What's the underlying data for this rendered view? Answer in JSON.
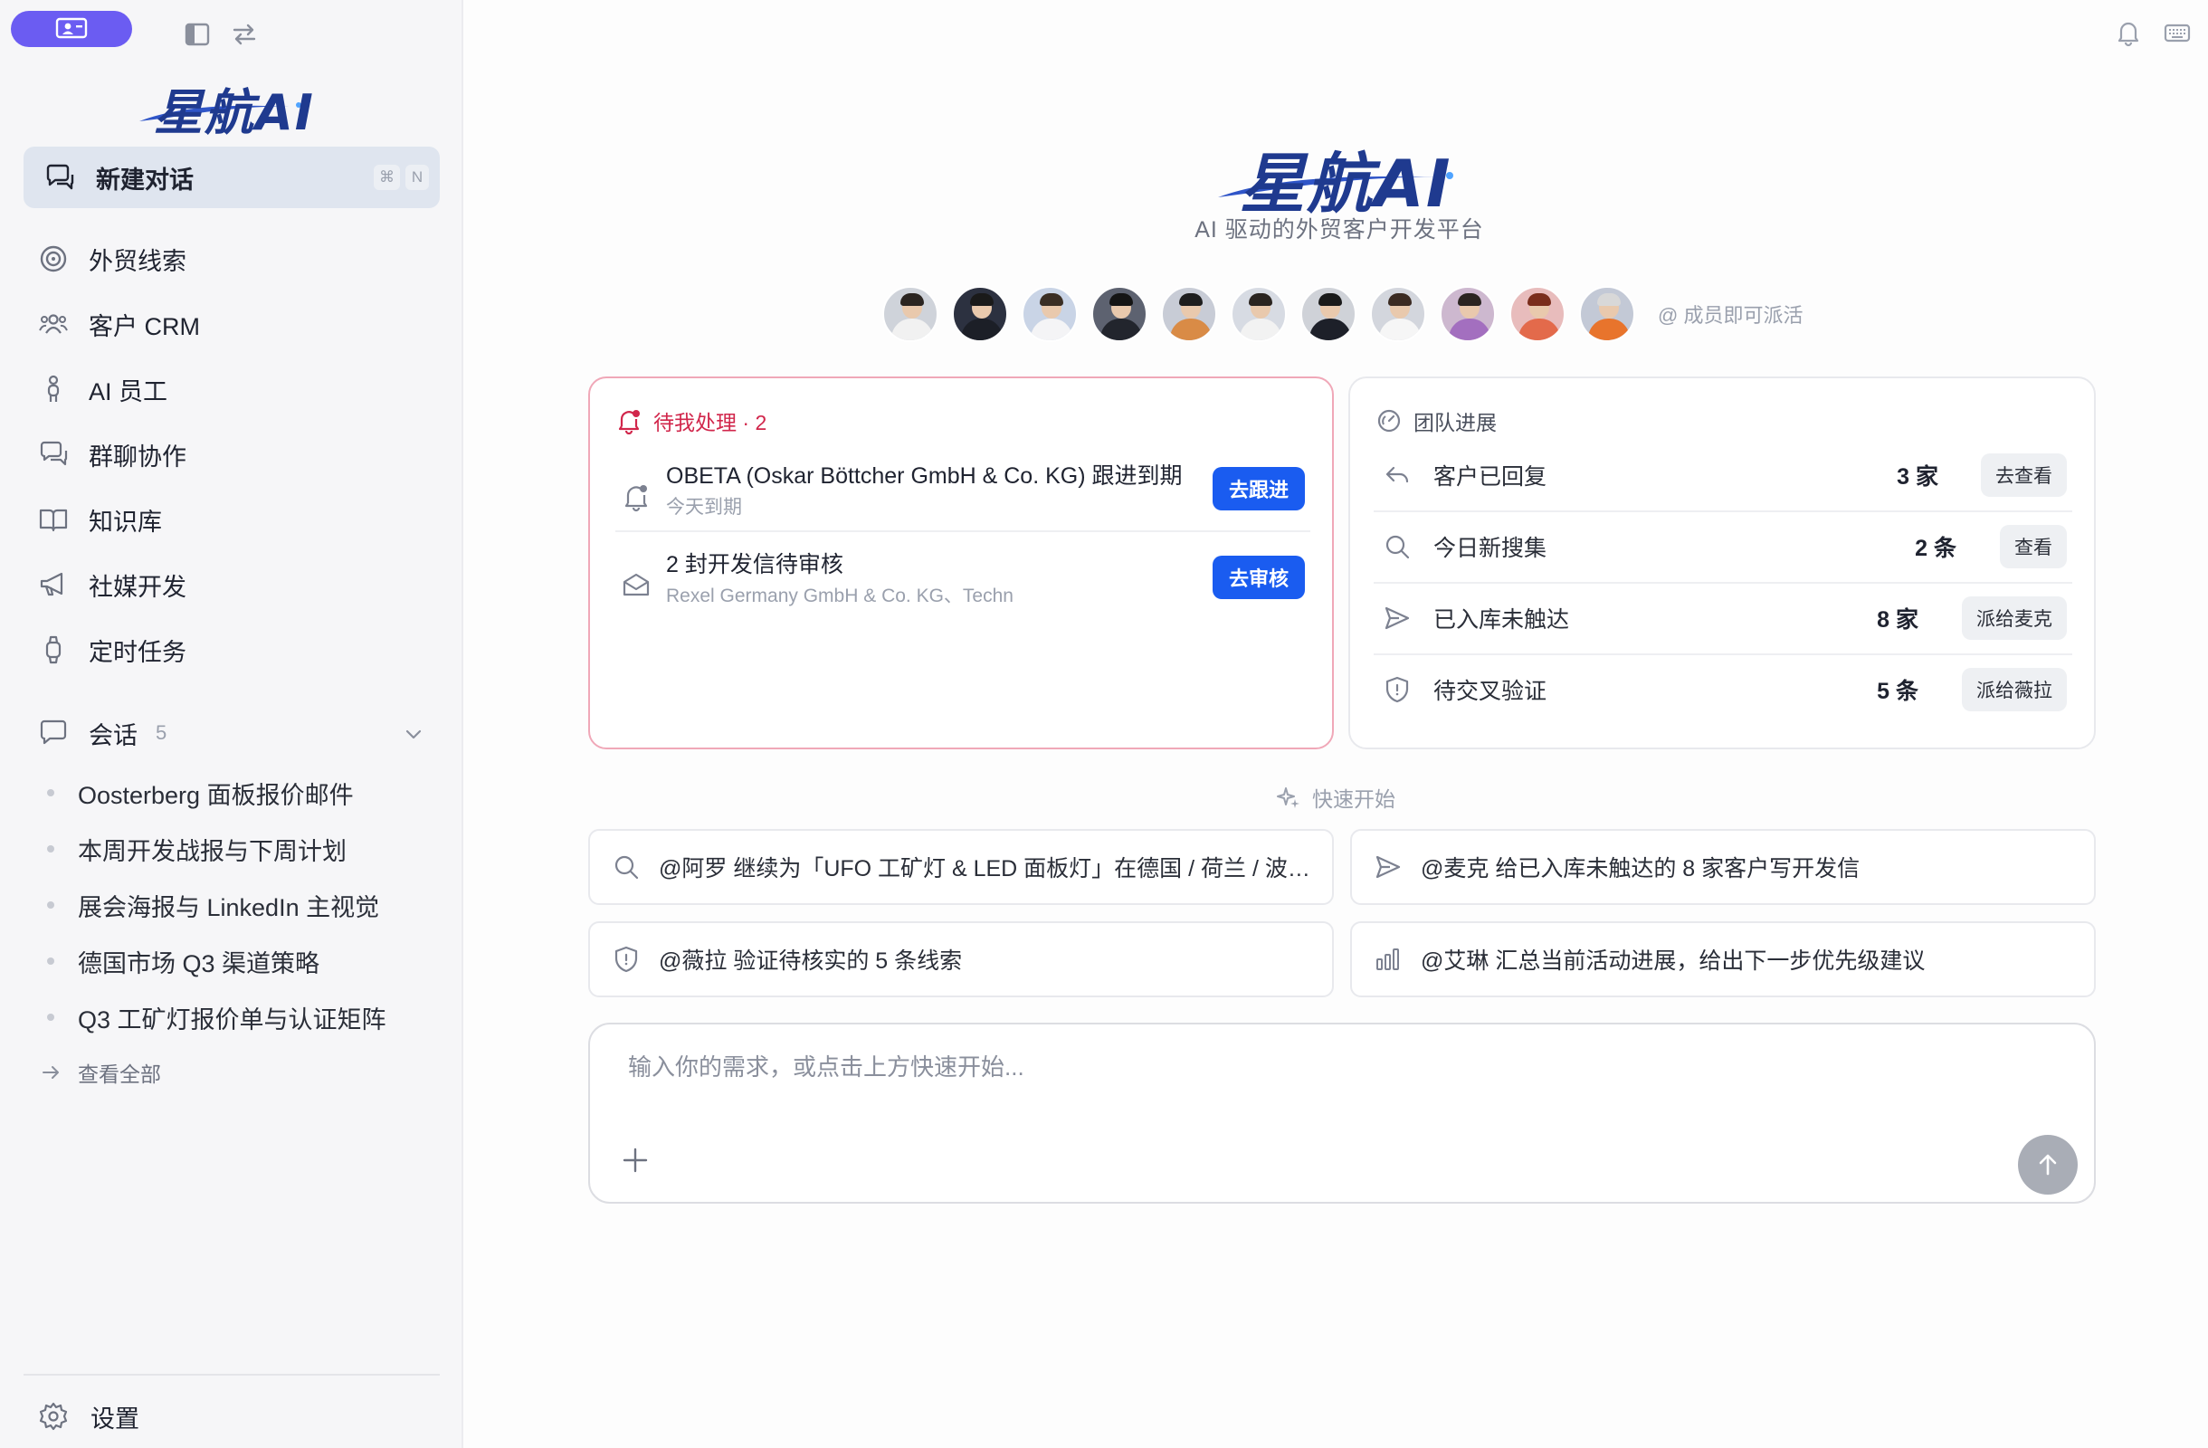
{
  "app": {
    "brand": "星航AI",
    "tagline": "AI 驱动的外贸客户开发平台",
    "accent": "#1a5cf0",
    "pill_color": "#6b5cf2",
    "alert_color": "#d1264b"
  },
  "sidebar": {
    "new_chat": {
      "label": "新建对话",
      "shortcut_mod": "⌘",
      "shortcut_key": "N"
    },
    "nav": [
      {
        "label": "外贸线索",
        "icon": "target-icon"
      },
      {
        "label": "客户 CRM",
        "icon": "users-icon"
      },
      {
        "label": "AI 员工",
        "icon": "person-icon"
      },
      {
        "label": "群聊协作",
        "icon": "chat-bubbles-icon"
      },
      {
        "label": "知识库",
        "icon": "book-icon"
      },
      {
        "label": "社媒开发",
        "icon": "megaphone-icon"
      },
      {
        "label": "定时任务",
        "icon": "watch-icon"
      }
    ],
    "sessions": {
      "label": "会话",
      "count": "5",
      "items": [
        "Oosterberg 面板报价邮件",
        "本周开发战报与下周计划",
        "展会海报与 LinkedIn 主视觉",
        "德国市场 Q3 渠道策略",
        "Q3 工矿灯报价单与认证矩阵"
      ],
      "view_all": "查看全部"
    },
    "settings": "设置"
  },
  "avatars": {
    "hint": "@ 成员即可派活",
    "people": [
      {
        "bg": "#cfd3da",
        "body": "#f1f1f1",
        "hair": "#2b2521"
      },
      {
        "bg": "#2c3140",
        "body": "#1c1f27",
        "hair": "#1a1a1a"
      },
      {
        "bg": "#c9d4e6",
        "body": "#f4f4f6",
        "hair": "#3a2e24"
      },
      {
        "bg": "#5d6270",
        "body": "#22252d",
        "hair": "#151515"
      },
      {
        "bg": "#c8ccd6",
        "body": "#d98b46",
        "hair": "#1e1e1e"
      },
      {
        "bg": "#d7dbe3",
        "body": "#f2f2f2",
        "hair": "#2a2420"
      },
      {
        "bg": "#cfd2d8",
        "body": "#1d2029",
        "hair": "#1a1a1a"
      },
      {
        "bg": "#d3d6dd",
        "body": "#f6f6f6",
        "hair": "#3b2b22"
      },
      {
        "bg": "#cdb8cf",
        "body": "#a36fbf",
        "hair": "#2b2521"
      },
      {
        "bg": "#e8bcbc",
        "body": "#e36a4b",
        "hair": "#7a2d1c"
      },
      {
        "bg": "#c3c9d6",
        "body": "#e8742c",
        "hair": "#d8d8d8"
      }
    ]
  },
  "pending": {
    "title": "待我处理 · 2",
    "tasks": [
      {
        "title": "OBETA (Oskar Böttcher GmbH & Co. KG) 跟进到期",
        "sub": "今天到期",
        "action": "去跟进"
      },
      {
        "title": "2 封开发信待审核",
        "sub": "Rexel Germany GmbH & Co. KG、Techn",
        "action": "去审核"
      }
    ]
  },
  "team": {
    "title": "团队进展",
    "rows": [
      {
        "label": "客户已回复",
        "value": "3 家",
        "action": "去查看"
      },
      {
        "label": "今日新搜集",
        "value": "2 条",
        "action": "查看"
      },
      {
        "label": "已入库未触达",
        "value": "8 家",
        "action": "派给麦克"
      },
      {
        "label": "待交叉验证",
        "value": "5 条",
        "action": "派给薇拉"
      }
    ]
  },
  "quick_start": {
    "title": "快速开始",
    "items": [
      "@阿罗 继续为「UFO 工矿灯 & LED 面板灯」在德国 / 荷兰 / 波兰搜集新的分销商线索",
      "@麦克 给已入库未触达的 8 家客户写开发信",
      "@薇拉 验证待核实的 5 条线索",
      "@艾琳 汇总当前活动进展，给出下一步优先级建议"
    ]
  },
  "composer": {
    "placeholder": "输入你的需求，或点击上方快速开始..."
  }
}
